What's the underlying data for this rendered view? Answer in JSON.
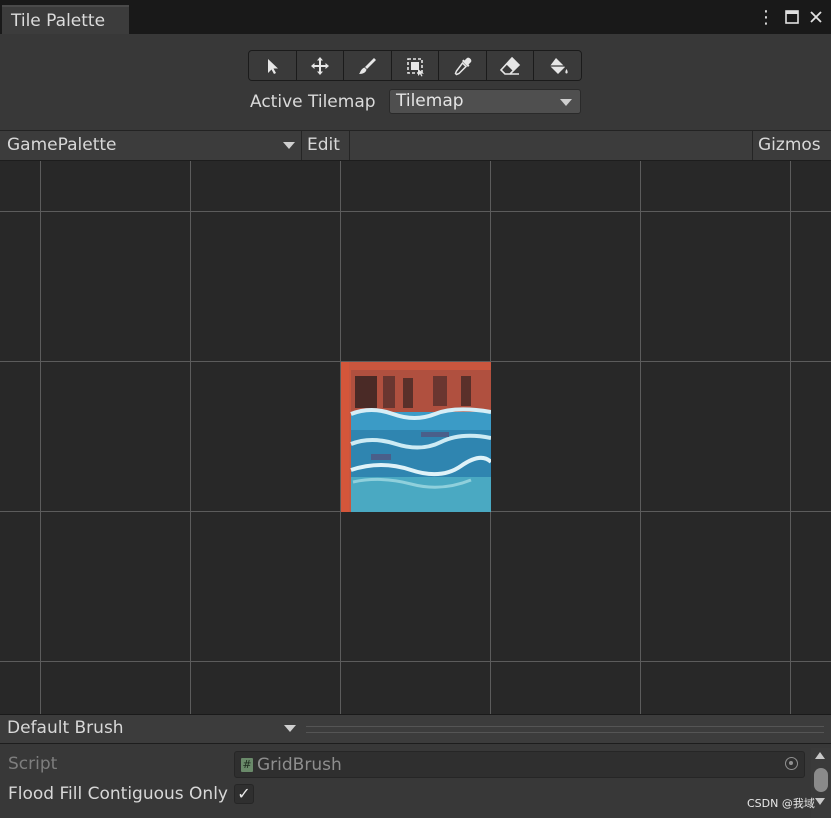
{
  "window": {
    "tab_title": "Tile Palette",
    "controls": [
      "more-vert-icon",
      "maximize-icon",
      "close-icon"
    ]
  },
  "toolbar": {
    "tools": [
      {
        "name": "select",
        "icon": "pointer-icon"
      },
      {
        "name": "move",
        "icon": "move-icon"
      },
      {
        "name": "paint",
        "icon": "brush-icon"
      },
      {
        "name": "box-fill",
        "icon": "box-select-icon"
      },
      {
        "name": "pick",
        "icon": "eyedropper-icon"
      },
      {
        "name": "erase",
        "icon": "eraser-icon"
      },
      {
        "name": "fill",
        "icon": "bucket-fill-icon"
      }
    ],
    "active_tilemap_label": "Active Tilemap",
    "active_tilemap_value": "Tilemap"
  },
  "palette_bar": {
    "palette_value": "GamePalette",
    "edit_label": "Edit",
    "gizmos_label": "Gizmos"
  },
  "grid": {
    "tile": "water-tile"
  },
  "brush": {
    "brush_value": "Default Brush",
    "script_label": "Script",
    "script_value": "GridBrush",
    "flood_fill_label": "Flood Fill Contiguous Only",
    "flood_fill_checked": true
  },
  "watermark": "CSDN @我域",
  "colors": {
    "background": "#383838",
    "grid_bg": "#282828",
    "grid_line": "#5c5c5c"
  }
}
